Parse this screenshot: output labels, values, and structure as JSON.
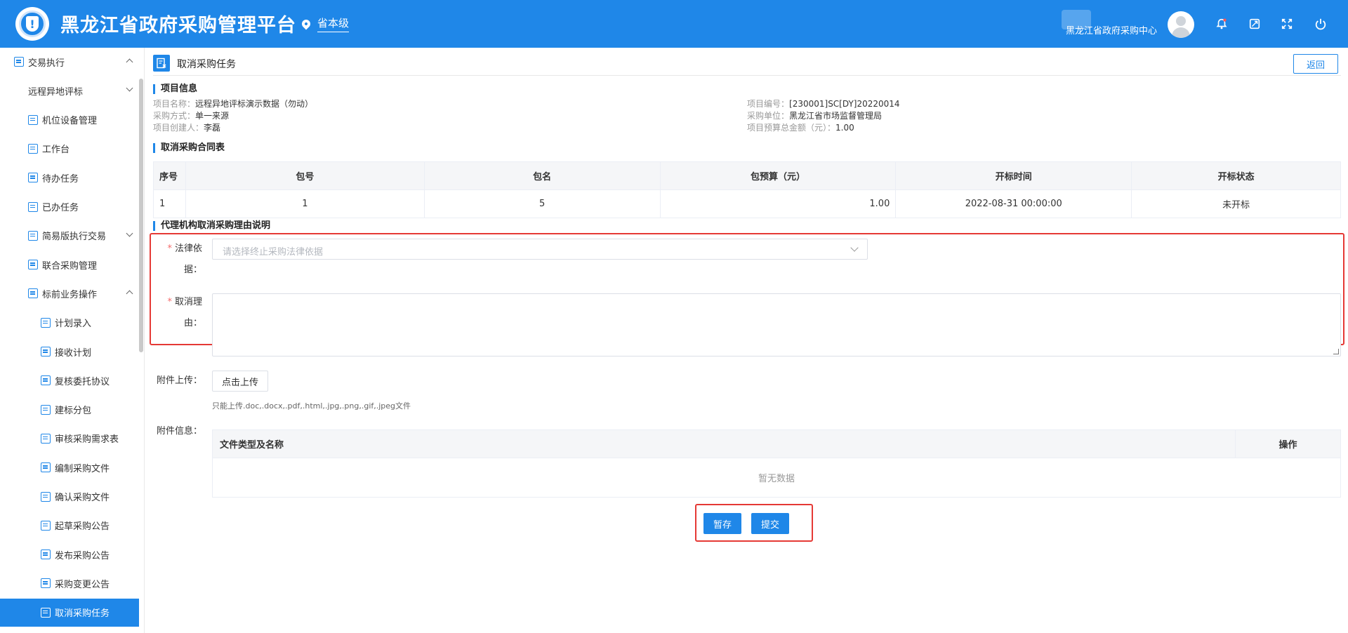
{
  "header": {
    "app_title": "黑龙江省政府采购管理平台",
    "region": "省本级",
    "user_name": "黑龙江省政府采购中心"
  },
  "icons": {
    "location": "location-pin-icon",
    "bell": "bell-icon",
    "screen": "screen-icon",
    "fullscreen": "fullscreen-icon",
    "power": "power-icon"
  },
  "colors": {
    "primary": "#1f87e8",
    "highlight": "#e53935",
    "required": "#f56c6c"
  },
  "sidebar": {
    "items": [
      {
        "label": "交易执行",
        "level": 1,
        "chevron": "up"
      },
      {
        "label": "远程异地评标",
        "level": 2,
        "chevron": "down"
      },
      {
        "label": "机位设备管理",
        "level": 2
      },
      {
        "label": "工作台",
        "level": 2
      },
      {
        "label": "待办任务",
        "level": 2
      },
      {
        "label": "已办任务",
        "level": 2
      },
      {
        "label": "简易版执行交易",
        "level": 2,
        "chevron": "down"
      },
      {
        "label": "联合采购管理",
        "level": 2
      },
      {
        "label": "标前业务操作",
        "level": 2,
        "chevron": "up"
      },
      {
        "label": "计划录入",
        "level": 3
      },
      {
        "label": "接收计划",
        "level": 3
      },
      {
        "label": "复核委托协议",
        "level": 3
      },
      {
        "label": "建标分包",
        "level": 3
      },
      {
        "label": "审核采购需求表",
        "level": 3
      },
      {
        "label": "编制采购文件",
        "level": 3
      },
      {
        "label": "确认采购文件",
        "level": 3
      },
      {
        "label": "起草采购公告",
        "level": 3
      },
      {
        "label": "发布采购公告",
        "level": 3
      },
      {
        "label": "采购变更公告",
        "level": 3
      },
      {
        "label": "取消采购任务",
        "level": 3,
        "active": true
      }
    ]
  },
  "page": {
    "title": "取消采购任务",
    "back_label": "返回"
  },
  "project_info": {
    "section_title": "项目信息",
    "left": [
      {
        "label": "项目名称：",
        "value": "远程异地评标演示数据（勿动）"
      },
      {
        "label": "采购方式：",
        "value": "单一来源"
      },
      {
        "label": "项目创建人：",
        "value": "李磊"
      }
    ],
    "right": [
      {
        "label": "项目编号：",
        "value": "[230001]SC[DY]20220014"
      },
      {
        "label": "采购单位：",
        "value": "黑龙江省市场监督管理局"
      },
      {
        "label": "项目预算总金额（元）：",
        "value": "1.00"
      }
    ]
  },
  "contract_table": {
    "section_title": "取消采购合同表",
    "columns": [
      "序号",
      "包号",
      "包名",
      "包预算（元）",
      "开标时间",
      "开标状态"
    ],
    "rows": [
      [
        "1",
        "1",
        "5",
        "1.00",
        "2022-08-31 00:00:00",
        "未开标"
      ]
    ]
  },
  "reason_form": {
    "section_title": "代理机构取消采购理由说明",
    "required_mark": "*",
    "legal_basis_label_1": "法律依",
    "legal_basis_label_2": "据：",
    "legal_basis_placeholder": "请选择终止采购法律依据",
    "reason_label_1": "取消理",
    "reason_label_2": "由："
  },
  "attachments": {
    "upload_label": "附件上传：",
    "upload_button": "点击上传",
    "hint": "只能上传.doc,.docx,.pdf,.html,.jpg,.png,.gif,.jpeg文件",
    "info_label": "附件信息：",
    "columns": [
      "文件类型及名称",
      "操作"
    ],
    "empty_text": "暂无数据"
  },
  "actions": {
    "save_label": "暂存",
    "submit_label": "提交"
  }
}
